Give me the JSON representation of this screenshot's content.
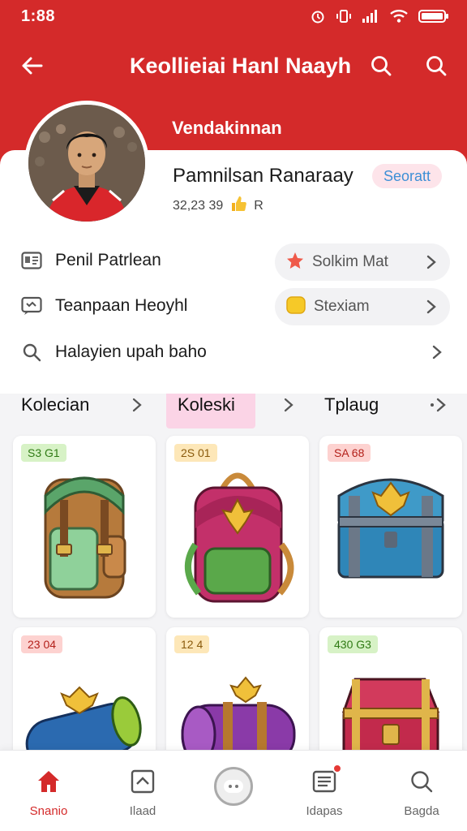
{
  "status_bar": {
    "time": "1:88"
  },
  "header": {
    "title": "Keollieiai Hanl Naayh",
    "subtitle": "Vendakinnan"
  },
  "profile": {
    "name": "Pamnilsan Ranaraay",
    "badge": "Seoratt",
    "stats": "32,23 39",
    "stats_suffix": "R"
  },
  "menu": [
    {
      "label": "Penil Patrlean",
      "icon": "id-card-icon"
    },
    {
      "label": "Teanpaan Heoyhl",
      "icon": "chat-icon"
    },
    {
      "label": "Halayien upah baho",
      "icon": "search-icon"
    }
  ],
  "pills": [
    {
      "label": "Solkim Mat",
      "icon": "star-icon"
    },
    {
      "label": "Stexiam",
      "icon": "coin-icon"
    }
  ],
  "tabs": [
    {
      "label": "Kolecian",
      "active": false
    },
    {
      "label": "Koleski",
      "active": true
    },
    {
      "label": "Tplaug",
      "active": false
    }
  ],
  "items": [
    {
      "tag": "S3 G1",
      "tag_color": "#4caf2a",
      "icon": "backpack-icon"
    },
    {
      "tag": "2S 01",
      "tag_color": "#f0b43a",
      "icon": "backpack-icon"
    },
    {
      "tag": "SA 68",
      "tag_color": "#e53935",
      "icon": "chest-icon"
    },
    {
      "tag": "23 04",
      "tag_color": "#e53935",
      "icon": "bedroll-icon"
    },
    {
      "tag": "12 4",
      "tag_color": "#f0b43a",
      "icon": "bedroll-icon"
    },
    {
      "tag": "430 G3",
      "tag_color": "#4caf2a",
      "icon": "chest-icon"
    }
  ],
  "bottom_nav": [
    {
      "label": "Snanio",
      "icon": "home-icon",
      "active": true
    },
    {
      "label": "Ilaad",
      "icon": "image-icon",
      "active": false
    },
    {
      "label": "Idapas",
      "icon": "document-icon",
      "active": false
    },
    {
      "label": "Bagda",
      "icon": "search-icon",
      "active": false
    }
  ],
  "colors": {
    "primary_red": "#d42a2a",
    "active_tab_bg": "#fbd4e6",
    "badge_text": "#3d8fd6"
  }
}
